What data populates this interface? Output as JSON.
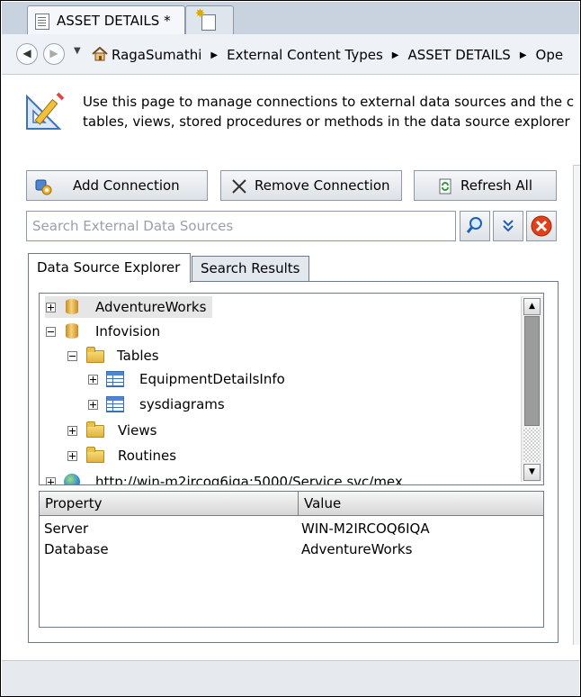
{
  "tab": {
    "title": "ASSET DETAILS *"
  },
  "breadcrumb": [
    "RagaSumathi",
    "External Content Types",
    "ASSET DETAILS",
    "Ope"
  ],
  "description": {
    "line1": "Use this page to manage connections to external data sources and the c",
    "line2": "tables, views, stored procedures or methods in the data source explorer"
  },
  "toolbar": {
    "add_label": "Add Connection",
    "remove_label": "Remove Connection",
    "refresh_label": "Refresh All"
  },
  "search": {
    "placeholder": "Search External Data Sources",
    "value": ""
  },
  "tabs": {
    "explorer": "Data Source Explorer",
    "results": "Search Results"
  },
  "tree": {
    "adventureworks": "AdventureWorks",
    "infovision": "Infovision",
    "tables": "Tables",
    "equipment": "EquipmentDetailsInfo",
    "sysdiagrams": "sysdiagrams",
    "views": "Views",
    "routines": "Routines",
    "service": "http://win-m2ircoq6iqa:5000/Service.svc/mex"
  },
  "properties": {
    "header_property": "Property",
    "header_value": "Value",
    "rows": [
      {
        "key": "Server",
        "value": "WIN-M2IRCOQ6IQA"
      },
      {
        "key": "Database",
        "value": "AdventureWorks"
      }
    ]
  },
  "colors": {
    "accent": "#1f5fb5",
    "close": "#e0401a"
  }
}
